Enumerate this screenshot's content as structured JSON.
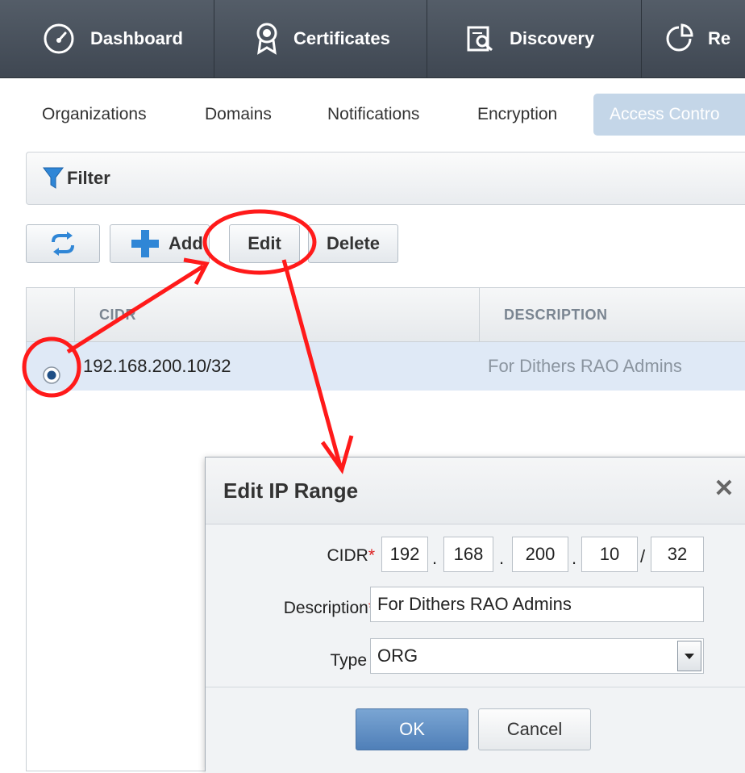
{
  "topnav": {
    "tabs": [
      {
        "label": "Dashboard",
        "icon": "speedometer-icon"
      },
      {
        "label": "Certificates",
        "icon": "certificate-badge-icon"
      },
      {
        "label": "Discovery",
        "icon": "discovery-search-icon"
      },
      {
        "label": "Re",
        "icon": "reports-pie-icon"
      }
    ]
  },
  "subnav": {
    "tabs": [
      "Organizations",
      "Domains",
      "Notifications",
      "Encryption",
      "Access Contro"
    ],
    "active_index": 4
  },
  "filter": {
    "label": "Filter",
    "icon": "funnel-icon"
  },
  "toolbar": {
    "refresh_icon": "refresh-icon",
    "add_label": "Add",
    "add_icon": "plus-icon",
    "edit_label": "Edit",
    "delete_label": "Delete"
  },
  "table": {
    "columns": [
      "CIDR",
      "DESCRIPTION"
    ],
    "rows": [
      {
        "cidr": "192.168.200.10/32",
        "description": "For Dithers RAO Admins",
        "selected": true
      }
    ]
  },
  "modal": {
    "title": "Edit IP Range",
    "close_icon": "close-icon",
    "cidr_label": "CIDR",
    "cidr_octets": [
      "192",
      "168",
      "200",
      "10"
    ],
    "cidr_prefix": "32",
    "description_label": "Description",
    "description_value": "For Dithers RAO Admins",
    "type_label": "Type",
    "type_value": "ORG",
    "required_mark": "*",
    "ok_label": "OK",
    "cancel_label": "Cancel"
  },
  "colors": {
    "nav_bg": "#4a525c",
    "selected_row": "#dfe9f6",
    "active_subtab": "#c4d6e8",
    "annotation": "#ff1a1a",
    "ok_button": "#5f8cc4"
  }
}
